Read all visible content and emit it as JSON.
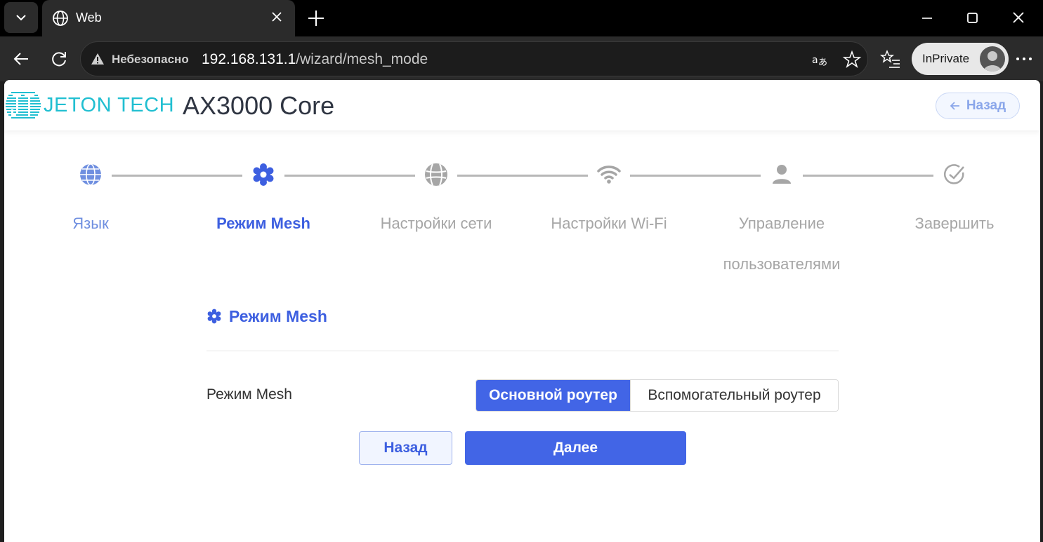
{
  "browser": {
    "tab_title": "Web",
    "security_label": "Небезопасно",
    "url_host": "192.168.131.1",
    "url_path": "/wizard/mesh_mode",
    "profile_label": "InPrivate"
  },
  "header": {
    "brand": "JETON TECH",
    "product": "AX3000 Core",
    "back_label": "Назад"
  },
  "steps": [
    {
      "label": "Язык",
      "icon": "globe-icon",
      "state": "done"
    },
    {
      "label": "Режим Mesh",
      "icon": "gear-icon",
      "state": "active"
    },
    {
      "label": "Настройки сети",
      "icon": "network-icon",
      "state": "pending"
    },
    {
      "label": "Настройки Wi-Fi",
      "icon": "wifi-icon",
      "state": "pending"
    },
    {
      "label": "Управление пользователями",
      "icon": "user-icon",
      "state": "pending"
    },
    {
      "label": "Завершить",
      "icon": "check-circle-icon",
      "state": "pending"
    }
  ],
  "section": {
    "title": "Режим Mesh",
    "field_label": "Режим Mesh",
    "options": [
      "Основной роутер",
      "Вспомогательный роутер"
    ],
    "selected": "Основной роутер"
  },
  "actions": {
    "back": "Назад",
    "next": "Далее"
  },
  "colors": {
    "accent": "#4265e6",
    "brand": "#21bfd1",
    "inactive": "#a6a6a6"
  }
}
